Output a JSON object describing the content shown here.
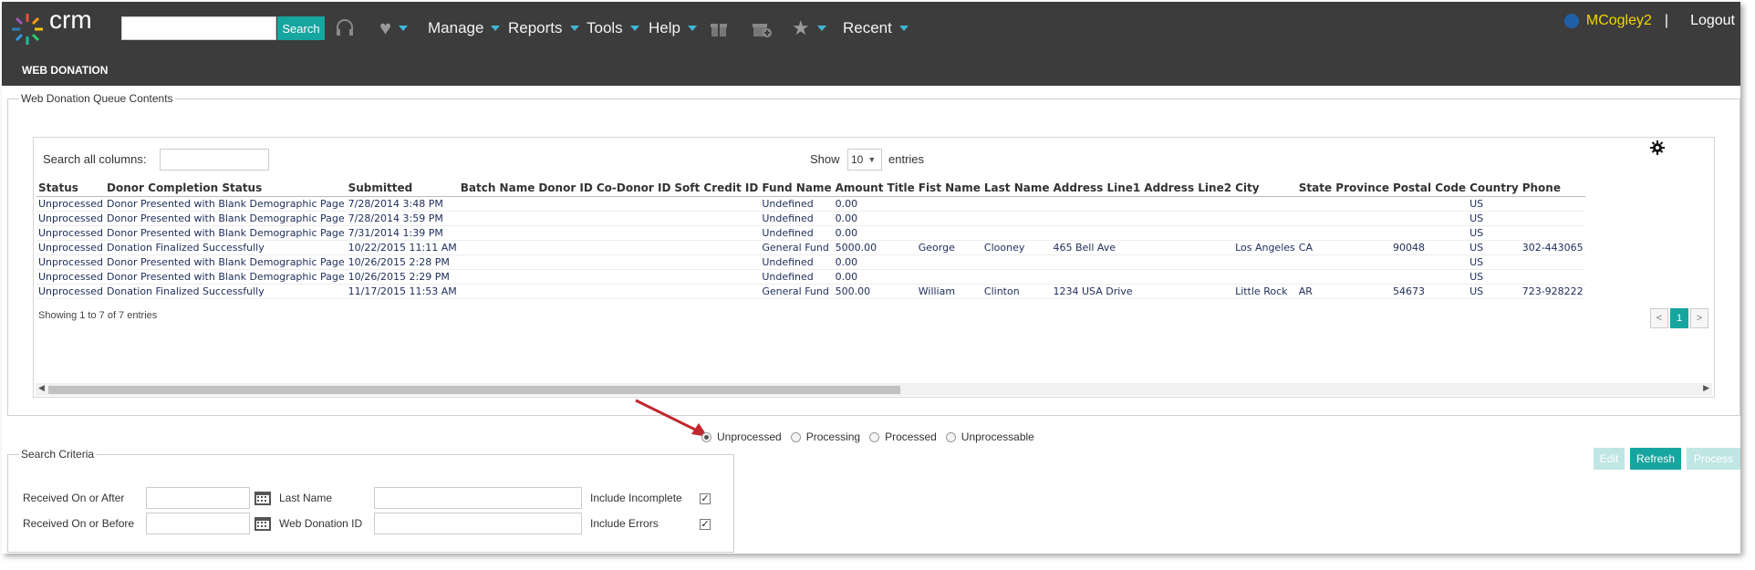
{
  "app": {
    "logo_text": "crm"
  },
  "header": {
    "search_button": "Search",
    "nav": [
      {
        "label": "Manage"
      },
      {
        "label": "Reports"
      },
      {
        "label": "Tools"
      },
      {
        "label": "Help"
      },
      {
        "label": "Recent"
      }
    ],
    "username": "MCogley2",
    "separator": "|",
    "logout": "Logout",
    "section_title": "WEB DONATION",
    "accent_color": "#3fb6d6",
    "username_color": "#f2d600"
  },
  "queue": {
    "legend": "Web Donation Queue Contents",
    "search_label": "Search all columns:",
    "show_label": "Show",
    "entries_value": "10",
    "entries_label": "entries",
    "info": "Showing 1 to 7 of 7 entries",
    "pager": {
      "prev": "<",
      "page": "1",
      "next": ">"
    },
    "columns": [
      "Status",
      "Donor Completion Status",
      "Submitted",
      "Batch Name",
      "Donor ID",
      "Co-Donor ID",
      "Soft Credit ID",
      "Fund Name",
      "Amount",
      "Title",
      "Fist Name",
      "Last Name",
      "Address Line1",
      "Address Line2",
      "City",
      "State Province",
      "Postal Code",
      "Country",
      "Phone"
    ],
    "rows": [
      [
        "Unprocessed",
        "Donor Presented with Blank Demographic Page",
        "7/28/2014 3:48 PM",
        "",
        "",
        "",
        "",
        "Undefined",
        "0.00",
        "",
        "",
        "",
        "",
        "",
        "",
        "",
        "",
        "US",
        ""
      ],
      [
        "Unprocessed",
        "Donor Presented with Blank Demographic Page",
        "7/28/2014 3:59 PM",
        "",
        "",
        "",
        "",
        "Undefined",
        "0.00",
        "",
        "",
        "",
        "",
        "",
        "",
        "",
        "",
        "US",
        ""
      ],
      [
        "Unprocessed",
        "Donor Presented with Blank Demographic Page",
        "7/31/2014 1:39 PM",
        "",
        "",
        "",
        "",
        "Undefined",
        "0.00",
        "",
        "",
        "",
        "",
        "",
        "",
        "",
        "",
        "US",
        ""
      ],
      [
        "Unprocessed",
        "Donation Finalized Successfully",
        "10/22/2015 11:11 AM",
        "",
        "",
        "",
        "",
        "General Fund",
        "5000.00",
        "",
        "George",
        "Clooney",
        "465 Bell Ave",
        "",
        "Los Angeles",
        "CA",
        "90048",
        "US",
        "302-443065"
      ],
      [
        "Unprocessed",
        "Donor Presented with Blank Demographic Page",
        "10/26/2015 2:28 PM",
        "",
        "",
        "",
        "",
        "Undefined",
        "0.00",
        "",
        "",
        "",
        "",
        "",
        "",
        "",
        "",
        "US",
        ""
      ],
      [
        "Unprocessed",
        "Donor Presented with Blank Demographic Page",
        "10/26/2015 2:29 PM",
        "",
        "",
        "",
        "",
        "Undefined",
        "0.00",
        "",
        "",
        "",
        "",
        "",
        "",
        "",
        "",
        "US",
        ""
      ],
      [
        "Unprocessed",
        "Donation Finalized Successfully",
        "11/17/2015 11:53 AM",
        "",
        "",
        "",
        "",
        "General Fund",
        "500.00",
        "",
        "William",
        "Clinton",
        "1234 USA Drive",
        "",
        "Little Rock",
        "AR",
        "54673",
        "US",
        "723-928222"
      ]
    ]
  },
  "status_filter": {
    "options": [
      "Unprocessed",
      "Processing",
      "Processed",
      "Unprocessable"
    ],
    "selected": "Unprocessed"
  },
  "actions": {
    "edit": "Edit",
    "refresh": "Refresh",
    "process": "Process"
  },
  "search_criteria": {
    "legend": "Search Criteria",
    "received_after": "Received On or After",
    "received_before": "Received On or Before",
    "last_name": "Last Name",
    "web_donation_id": "Web Donation ID",
    "include_incomplete": "Include Incomplete",
    "include_errors": "Include Errors"
  }
}
